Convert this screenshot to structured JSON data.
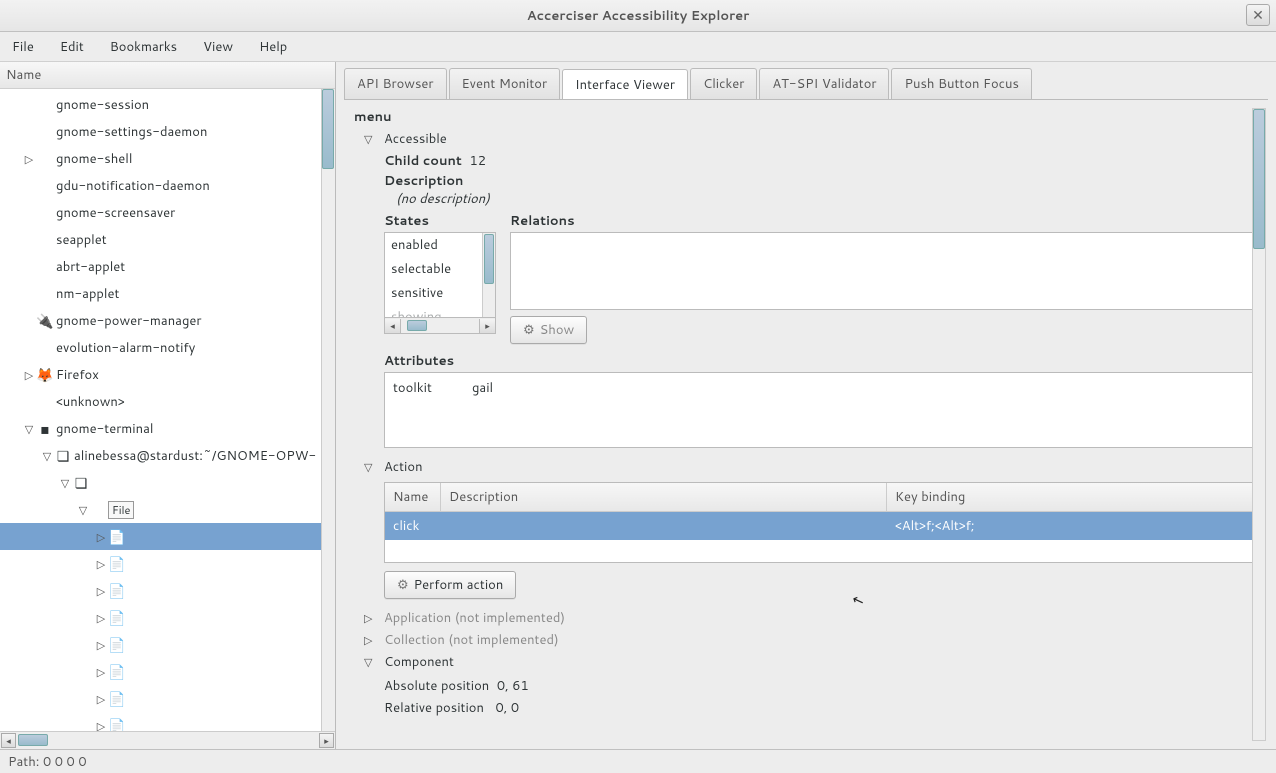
{
  "window": {
    "title": "Accerciser Accessibility Explorer"
  },
  "menubar": {
    "items": [
      "File",
      "Edit",
      "Bookmarks",
      "View",
      "Help"
    ]
  },
  "tree": {
    "column_header": "Name",
    "rows": [
      {
        "label": "gnome-session",
        "indent": 1,
        "expander": ""
      },
      {
        "label": "gnome-settings-daemon",
        "indent": 1,
        "expander": ""
      },
      {
        "label": "gnome-shell",
        "indent": 1,
        "expander": "right"
      },
      {
        "label": "gdu-notification-daemon",
        "indent": 1,
        "expander": ""
      },
      {
        "label": "gnome-screensaver",
        "indent": 1,
        "expander": ""
      },
      {
        "label": "seapplet",
        "indent": 1,
        "expander": ""
      },
      {
        "label": "abrt-applet",
        "indent": 1,
        "expander": ""
      },
      {
        "label": "nm-applet",
        "indent": 1,
        "expander": ""
      },
      {
        "label": "gnome-power-manager",
        "indent": 1,
        "expander": "",
        "icon": "🔌"
      },
      {
        "label": "evolution-alarm-notify",
        "indent": 1,
        "expander": ""
      },
      {
        "label": "Firefox",
        "indent": 1,
        "expander": "right",
        "icon": "🦊"
      },
      {
        "label": "<unknown>",
        "indent": 1,
        "expander": ""
      },
      {
        "label": "gnome-terminal",
        "indent": 1,
        "expander": "down",
        "icon": "▪"
      },
      {
        "label": "alinebessa@stardust:~/GNOME-OPW-",
        "indent": 2,
        "expander": "down",
        "icon": "❏"
      },
      {
        "label": "",
        "indent": 3,
        "expander": "down",
        "icon": "❏"
      },
      {
        "label": "File",
        "indent": 4,
        "expander": "down",
        "badge": true
      },
      {
        "label": "",
        "indent": 5,
        "expander": "right",
        "icon": "doc",
        "selected": true
      },
      {
        "label": "",
        "indent": 5,
        "expander": "right",
        "icon": "doc"
      },
      {
        "label": "",
        "indent": 5,
        "expander": "right",
        "icon": "doc"
      },
      {
        "label": "",
        "indent": 5,
        "expander": "right",
        "icon": "doc"
      },
      {
        "label": "",
        "indent": 5,
        "expander": "right",
        "icon": "doc"
      },
      {
        "label": "",
        "indent": 5,
        "expander": "right",
        "icon": "doc"
      },
      {
        "label": "",
        "indent": 5,
        "expander": "right",
        "icon": "doc"
      },
      {
        "label": "",
        "indent": 5,
        "expander": "right",
        "icon": "doc"
      }
    ]
  },
  "tabs": {
    "items": [
      "API Browser",
      "Event Monitor",
      "Interface Viewer",
      "Clicker",
      "AT-SPI Validator",
      "Push Button Focus"
    ],
    "active_index": 2
  },
  "iface": {
    "node_name": "menu",
    "accessible_label": "Accessible",
    "child_count_label": "Child count",
    "child_count_value": "12",
    "description_label": "Description",
    "description_value": "(no description)",
    "states_label": "States",
    "states": [
      "enabled",
      "selectable",
      "sensitive",
      "showing"
    ],
    "relations_label": "Relations",
    "show_button": "Show",
    "attributes_label": "Attributes",
    "attributes": {
      "key": "toolkit",
      "value": "gail"
    },
    "action_label": "Action",
    "action_table": {
      "headers": {
        "name": "Name",
        "desc": "Description",
        "key": "Key binding"
      },
      "row": {
        "name": "click",
        "desc": "",
        "key": "<Alt>f;<Alt>f;"
      }
    },
    "perform_button": "Perform action",
    "app_section": "Application (not implemented)",
    "coll_section": "Collection (not implemented)",
    "component_label": "Component",
    "abs_pos_label": "Absolute position",
    "abs_pos_value": "0, 61",
    "rel_pos_label": "Relative position",
    "rel_pos_value": "0, 0"
  },
  "statusbar": {
    "path_label": "Path: 0 0 0 0"
  }
}
